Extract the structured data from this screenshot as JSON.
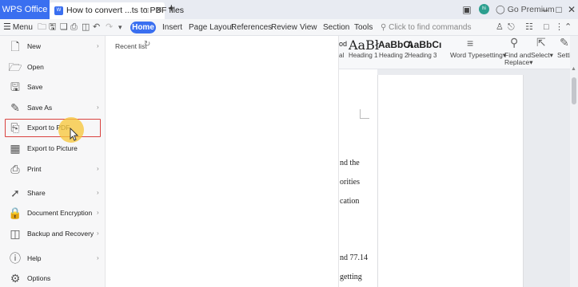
{
  "titlebar": {
    "app_tab": "WPS Office",
    "doc_tab": "How to convert ...ts to PDF files",
    "doc_icon_letter": "W",
    "new_tab_glyph": "+",
    "avatar_text": "hi",
    "premium": "Go Premium"
  },
  "tabrow": {
    "menu_label": "Menu",
    "tabs": [
      "Home",
      "Insert",
      "Page Layout",
      "References",
      "Review",
      "View",
      "Section",
      "Tools"
    ],
    "search_placeholder": "Click to find commands"
  },
  "ribbon": {
    "styles": [
      {
        "sample": "od",
        "caption": "al"
      },
      {
        "sample": "AaBł",
        "caption": "Heading 1"
      },
      {
        "sample": "AaBbCı",
        "caption": "Heading 2"
      },
      {
        "sample": "AaBbCı",
        "caption": "Heading 3"
      }
    ],
    "word_typesetting": "Word Typesetting",
    "find_replace_line1": "Find and",
    "find_replace_line2": "Replace",
    "select": "Select",
    "setting": "Settin"
  },
  "menu": {
    "items": [
      {
        "label": "New",
        "icon": "new-doc-icon",
        "arrow": true
      },
      {
        "label": "Open",
        "icon": "folder-icon",
        "arrow": false
      },
      {
        "label": "Save",
        "icon": "save-icon",
        "arrow": false
      },
      {
        "label": "Save As",
        "icon": "save-as-icon",
        "arrow": true
      },
      {
        "label": "Export to PDF",
        "icon": "export-pdf-icon",
        "arrow": false
      },
      {
        "label": "Export to Picture",
        "icon": "export-picture-icon",
        "arrow": false
      },
      {
        "label": "Print",
        "icon": "printer-icon",
        "arrow": true
      },
      {
        "label": "Share",
        "icon": "share-icon",
        "arrow": true
      },
      {
        "label": "Document Encryption",
        "icon": "encryption-icon",
        "arrow": true
      },
      {
        "label": "Backup and Recovery",
        "icon": "backup-icon",
        "arrow": true
      },
      {
        "label": "Help",
        "icon": "help-icon",
        "arrow": true
      },
      {
        "label": "Options",
        "icon": "gear-icon",
        "arrow": false
      }
    ]
  },
  "recent": {
    "label": "Recent list"
  },
  "document": {
    "lines": [
      "nd   the",
      "orities",
      "cation",
      "nd 77.14",
      "getting"
    ]
  }
}
